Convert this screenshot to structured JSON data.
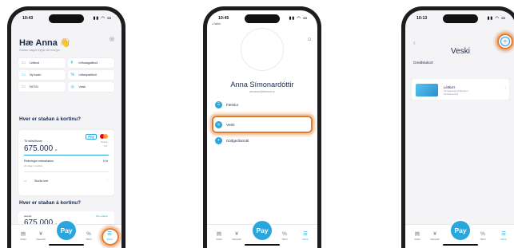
{
  "colors": {
    "accent": "#2aa6dd",
    "highlight": "#e27b2e",
    "text": "#1a2a4a"
  },
  "phone1": {
    "time": "10:43",
    "greeting": "Hæ Anna 👋",
    "subtitle": "Góðan dagur byrjar að morgni",
    "tiles": [
      {
        "icon": "card-icon",
        "glyph": "▭",
        "label": "Léttkort"
      },
      {
        "icon": "fork-knife-icon",
        "glyph": "¥",
        "label": "Þrifudagstilboð"
      },
      {
        "icon": "card-icon",
        "glyph": "▭",
        "label": "Ný bodm"
      },
      {
        "icon": "percent-icon",
        "glyph": "%",
        "label": "Léttaupstilboð"
      },
      {
        "icon": "card-icon",
        "glyph": "▭",
        "label": "NXT01"
      },
      {
        "icon": "wallet-icon",
        "glyph": "◎",
        "label": "Veski"
      }
    ],
    "section1": "Hver er staðan á kortinu?",
    "card": {
      "pay": "Pay",
      "label": "Til ráðstöfunar",
      "amount": "675.000",
      "currency": "kr.",
      "right_label": "Notkun",
      "right_value": "0 kr.",
      "billing_label": "Reikningur mánaðarins",
      "billing_sub": "20 dagar í greiðslu",
      "billing_value": "0 kr",
      "switch_label": "Skoða kort"
    },
    "section2": "Hver er staðan á kortinu?",
    "card2": {
      "label": "Heimild",
      "amount": "675.000",
      "currency": "kr.",
      "pay": "Pay Léttkort"
    }
  },
  "phone2": {
    "time": "10:45",
    "back_hint": "◂ Safari",
    "name": "Anna Símonardóttir",
    "email": "annasim@simnet.is",
    "items": [
      {
        "icon": "person-icon",
        "glyph": "☰",
        "label": "Færslur"
      },
      {
        "icon": "wallet-icon",
        "glyph": "◎",
        "label": "Veski"
      },
      {
        "icon": "gift-icon",
        "glyph": "✦",
        "label": "Góðgerðarmál"
      }
    ]
  },
  "phone3": {
    "time": "10:13",
    "back": "‹",
    "title": "Veski",
    "section": "Greiðslukort",
    "card_title": "Léttkort",
    "card_line1": "Sveigjanlegt greiðslukort",
    "card_line2": "frá Mastercard",
    "chevron": "›"
  },
  "tabbar": {
    "pay": "Pay",
    "tabs": [
      {
        "glyph": "▤",
        "label": "Staða"
      },
      {
        "glyph": "¥",
        "label": "Matseðill"
      },
      {
        "glyph": "%",
        "label": "Tilboð"
      },
      {
        "glyph": "☰",
        "label": "Meira"
      }
    ]
  }
}
